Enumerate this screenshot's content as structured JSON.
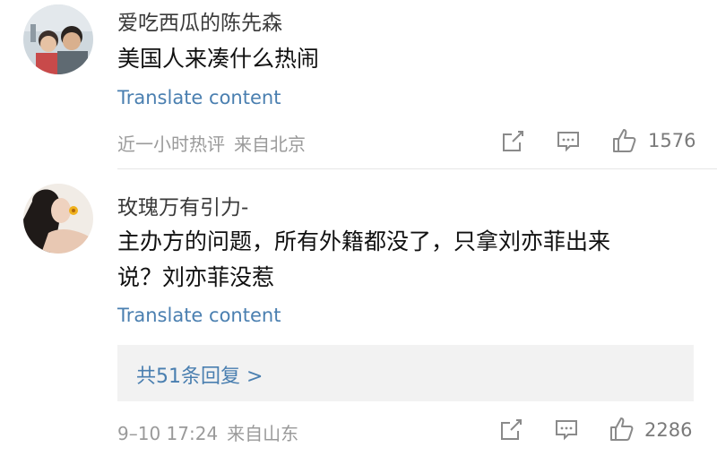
{
  "comments": [
    {
      "username": "爱吃西瓜的陈先森",
      "text": "美国人来凑什么热闹",
      "translate": "Translate content",
      "time": "近一小时热评",
      "location": "来自北京",
      "likes": "1576",
      "icons": {
        "share": "share-icon",
        "comment": "comment-icon",
        "like": "thumbs-up-icon"
      }
    },
    {
      "username": "玫瑰万有引力-",
      "text_line1": "主办方的问题，所有外籍都没了，只拿刘亦菲出来",
      "text_line2": "说？刘亦菲没惹",
      "translate": "Translate content",
      "replies": "共51条回复 >",
      "time": "9–10 17:24",
      "location": "来自山东",
      "likes": "2286",
      "icons": {
        "share": "share-icon",
        "comment": "comment-icon",
        "like": "thumbs-up-icon"
      }
    }
  ],
  "colors": {
    "link": "#4a7fb0",
    "meta": "#9a9a9a",
    "text": "#111111"
  }
}
